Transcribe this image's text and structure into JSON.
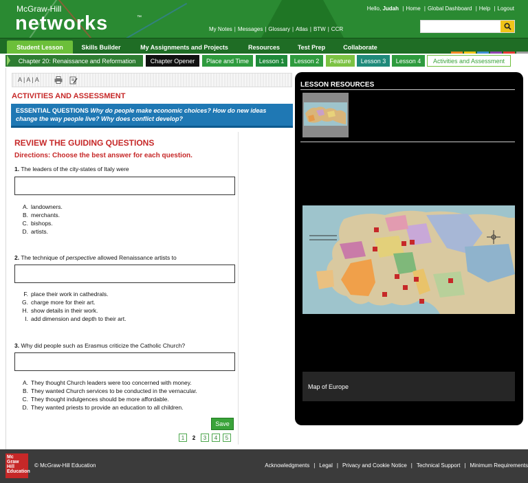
{
  "header": {
    "brand_small": "McGraw-Hill",
    "brand_big": "networks",
    "trademark": "™",
    "greeting_prefix": "Hello,",
    "user_name": "Judah",
    "user_links": [
      "Home",
      "Global Dashboard",
      "Help",
      "Logout"
    ],
    "util_links": [
      "My Notes",
      "Messages",
      "Glossary",
      "Atlas",
      "BTW",
      "CCR"
    ],
    "search_placeholder": ""
  },
  "main_nav": {
    "tabs": [
      "Student Lesson",
      "Skills Builder",
      "My Assignments and Projects",
      "Resources",
      "Test Prep",
      "Collaborate"
    ],
    "active": "Student Lesson",
    "accent_colors": [
      "#f08a24",
      "#f0c419",
      "#3f8fd2",
      "#8e44ad",
      "#e53935",
      "#9e9e9e"
    ]
  },
  "chapter_nav": {
    "chapter": "Chapter 20: Renaissance and Reformation",
    "items": [
      "Chapter Opener",
      "Place and Time",
      "Lesson 1",
      "Lesson 2",
      "Feature",
      "Lesson 3",
      "Lesson 4",
      "Activities and Assessment"
    ],
    "active": "Activities and Assessment"
  },
  "toolbar": {
    "font_sizes": "A | A | A",
    "icons": [
      "print-icon",
      "notes-icon"
    ]
  },
  "content": {
    "section_heading": "ACTIVITIES AND ASSESSMENT",
    "eq_label": "ESSENTIAL QUESTIONS",
    "eq_text": "Why do people make economic choices? How do new ideas change the way people live? Why does conflict develop?",
    "heading": "REVIEW THE GUIDING QUESTIONS",
    "directions": "Directions: Choose the best answer for each question.",
    "questions": [
      {
        "number": "1.",
        "pre": "The leaders of the city-states of Italy were",
        "em": "",
        "post": "",
        "options": [
          {
            "key": "A.",
            "text": "landowners."
          },
          {
            "key": "B.",
            "text": "merchants."
          },
          {
            "key": "C.",
            "text": "bishops."
          },
          {
            "key": "D.",
            "text": "artists."
          }
        ]
      },
      {
        "number": "2.",
        "pre": "The technique of",
        "em": "perspective",
        "post": "allowed Renaissance artists to",
        "options": [
          {
            "key": "F.",
            "text": "place their work in cathedrals."
          },
          {
            "key": "G.",
            "text": "charge more for their art."
          },
          {
            "key": "H.",
            "text": "show details in their work."
          },
          {
            "key": "I.",
            "text": "add dimension and depth to their art."
          }
        ]
      },
      {
        "number": "3.",
        "pre": "Why did people such as Erasmus criticize the Catholic Church?",
        "em": "",
        "post": "",
        "options": [
          {
            "key": "A.",
            "text": "They thought Church leaders were too concerned with money."
          },
          {
            "key": "B.",
            "text": "They wanted Church services to be conducted in the vernacular."
          },
          {
            "key": "C.",
            "text": "They thought indulgences should be more affordable."
          },
          {
            "key": "D.",
            "text": "They wanted priests to provide an education to all children."
          }
        ]
      }
    ],
    "save_label": "Save",
    "pages": [
      "1",
      "2",
      "3",
      "4",
      "5"
    ],
    "current_page": "2"
  },
  "resources": {
    "title": "LESSON RESOURCES",
    "map_caption": "Map of Europe"
  },
  "footer": {
    "logo_text": "Mc Graw Hill Education",
    "copyright": "© McGraw-Hill Education",
    "links": [
      "Acknowledgments",
      "Legal",
      "Privacy and Cookie Notice",
      "Technical Support",
      "Minimum Requirements"
    ]
  }
}
